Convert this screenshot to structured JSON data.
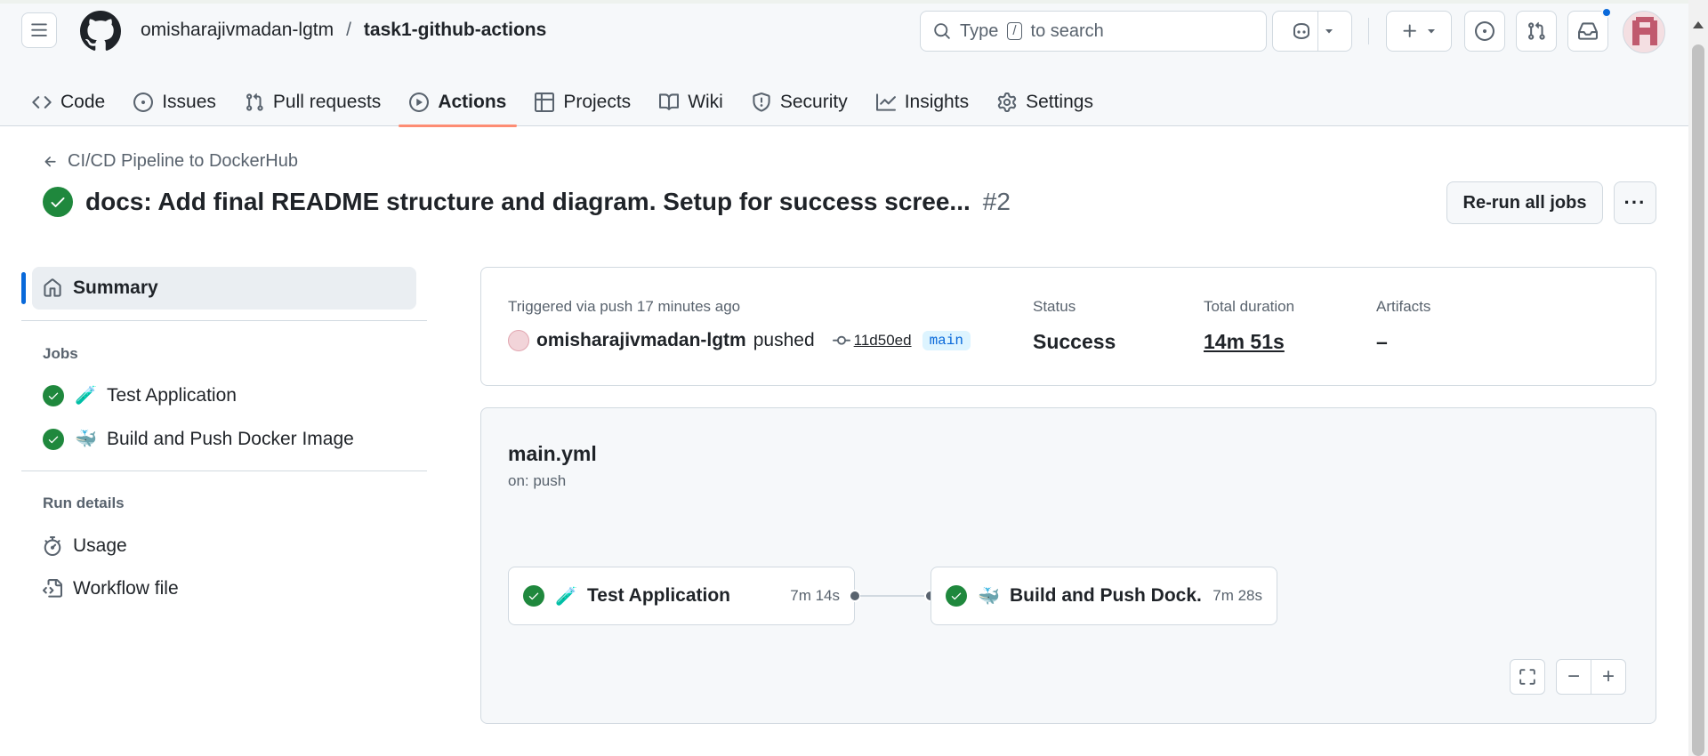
{
  "header": {
    "owner": "omisharajivmadan-lgtm",
    "separator": "/",
    "repo": "task1-github-actions",
    "search_prefix": "Type",
    "search_key": "/",
    "search_suffix": "to search"
  },
  "tabs": [
    {
      "label": "Code",
      "icon": "code-icon"
    },
    {
      "label": "Issues",
      "icon": "issue-icon"
    },
    {
      "label": "Pull requests",
      "icon": "pull-request-icon"
    },
    {
      "label": "Actions",
      "icon": "play-icon",
      "active": true
    },
    {
      "label": "Projects",
      "icon": "table-icon"
    },
    {
      "label": "Wiki",
      "icon": "book-icon"
    },
    {
      "label": "Security",
      "icon": "shield-icon"
    },
    {
      "label": "Insights",
      "icon": "graph-icon"
    },
    {
      "label": "Settings",
      "icon": "gear-icon"
    }
  ],
  "run": {
    "back_label": "CI/CD Pipeline to DockerHub",
    "title": "docs: Add final README structure and diagram. Setup for success scree...",
    "number": "#2",
    "rerun_label": "Re-run all jobs",
    "more_label": "···"
  },
  "sidebar": {
    "summary_label": "Summary",
    "jobs_heading": "Jobs",
    "jobs": [
      {
        "emoji": "🧪",
        "label": "Test Application"
      },
      {
        "emoji": "🐳",
        "label": "Build and Push Docker Image"
      }
    ],
    "run_details_heading": "Run details",
    "usage_label": "Usage",
    "workflow_file_label": "Workflow file"
  },
  "info": {
    "triggered": "Triggered via push 17 minutes ago",
    "actor": "omisharajivmadan-lgtm",
    "action": "pushed",
    "sha": "11d50ed",
    "branch": "main",
    "status_label": "Status",
    "status_value": "Success",
    "duration_label": "Total duration",
    "duration_value": "14m 51s",
    "artifacts_label": "Artifacts",
    "artifacts_value": "–"
  },
  "graph": {
    "workflow_name": "main.yml",
    "trigger": "on: push",
    "jobs": [
      {
        "emoji": "🧪",
        "name": "Test Application",
        "duration": "7m 14s"
      },
      {
        "emoji": "🐳",
        "name": "Build and Push Dock...",
        "duration": "7m 28s"
      }
    ],
    "zoom_out": "−",
    "zoom_in": "+"
  },
  "colors": {
    "success": "#1f883d",
    "accent": "#0969da",
    "active_tab_underline": "#fd8c73"
  }
}
